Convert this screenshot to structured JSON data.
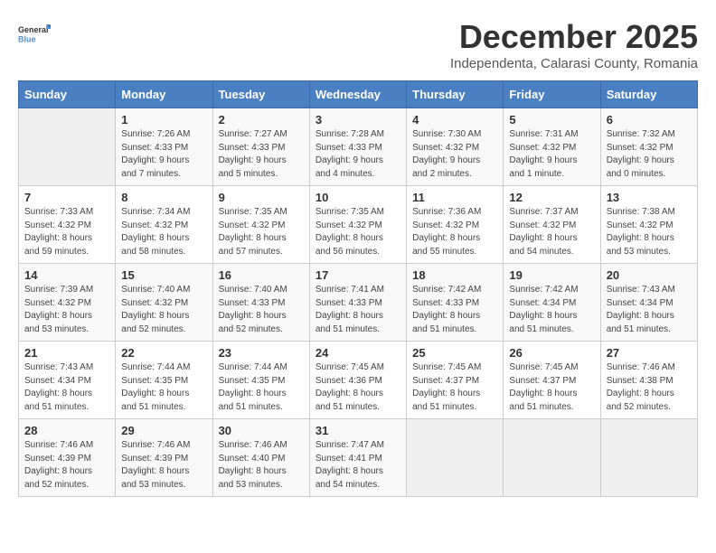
{
  "logo": {
    "general": "General",
    "blue": "Blue"
  },
  "header": {
    "month": "December 2025",
    "location": "Independenta, Calarasi County, Romania"
  },
  "weekdays": [
    "Sunday",
    "Monday",
    "Tuesday",
    "Wednesday",
    "Thursday",
    "Friday",
    "Saturday"
  ],
  "weeks": [
    [
      {
        "day": "",
        "sunrise": "",
        "sunset": "",
        "daylight": ""
      },
      {
        "day": "1",
        "sunrise": "Sunrise: 7:26 AM",
        "sunset": "Sunset: 4:33 PM",
        "daylight": "Daylight: 9 hours and 7 minutes."
      },
      {
        "day": "2",
        "sunrise": "Sunrise: 7:27 AM",
        "sunset": "Sunset: 4:33 PM",
        "daylight": "Daylight: 9 hours and 5 minutes."
      },
      {
        "day": "3",
        "sunrise": "Sunrise: 7:28 AM",
        "sunset": "Sunset: 4:33 PM",
        "daylight": "Daylight: 9 hours and 4 minutes."
      },
      {
        "day": "4",
        "sunrise": "Sunrise: 7:30 AM",
        "sunset": "Sunset: 4:32 PM",
        "daylight": "Daylight: 9 hours and 2 minutes."
      },
      {
        "day": "5",
        "sunrise": "Sunrise: 7:31 AM",
        "sunset": "Sunset: 4:32 PM",
        "daylight": "Daylight: 9 hours and 1 minute."
      },
      {
        "day": "6",
        "sunrise": "Sunrise: 7:32 AM",
        "sunset": "Sunset: 4:32 PM",
        "daylight": "Daylight: 9 hours and 0 minutes."
      }
    ],
    [
      {
        "day": "7",
        "sunrise": "Sunrise: 7:33 AM",
        "sunset": "Sunset: 4:32 PM",
        "daylight": "Daylight: 8 hours and 59 minutes."
      },
      {
        "day": "8",
        "sunrise": "Sunrise: 7:34 AM",
        "sunset": "Sunset: 4:32 PM",
        "daylight": "Daylight: 8 hours and 58 minutes."
      },
      {
        "day": "9",
        "sunrise": "Sunrise: 7:35 AM",
        "sunset": "Sunset: 4:32 PM",
        "daylight": "Daylight: 8 hours and 57 minutes."
      },
      {
        "day": "10",
        "sunrise": "Sunrise: 7:35 AM",
        "sunset": "Sunset: 4:32 PM",
        "daylight": "Daylight: 8 hours and 56 minutes."
      },
      {
        "day": "11",
        "sunrise": "Sunrise: 7:36 AM",
        "sunset": "Sunset: 4:32 PM",
        "daylight": "Daylight: 8 hours and 55 minutes."
      },
      {
        "day": "12",
        "sunrise": "Sunrise: 7:37 AM",
        "sunset": "Sunset: 4:32 PM",
        "daylight": "Daylight: 8 hours and 54 minutes."
      },
      {
        "day": "13",
        "sunrise": "Sunrise: 7:38 AM",
        "sunset": "Sunset: 4:32 PM",
        "daylight": "Daylight: 8 hours and 53 minutes."
      }
    ],
    [
      {
        "day": "14",
        "sunrise": "Sunrise: 7:39 AM",
        "sunset": "Sunset: 4:32 PM",
        "daylight": "Daylight: 8 hours and 53 minutes."
      },
      {
        "day": "15",
        "sunrise": "Sunrise: 7:40 AM",
        "sunset": "Sunset: 4:32 PM",
        "daylight": "Daylight: 8 hours and 52 minutes."
      },
      {
        "day": "16",
        "sunrise": "Sunrise: 7:40 AM",
        "sunset": "Sunset: 4:33 PM",
        "daylight": "Daylight: 8 hours and 52 minutes."
      },
      {
        "day": "17",
        "sunrise": "Sunrise: 7:41 AM",
        "sunset": "Sunset: 4:33 PM",
        "daylight": "Daylight: 8 hours and 51 minutes."
      },
      {
        "day": "18",
        "sunrise": "Sunrise: 7:42 AM",
        "sunset": "Sunset: 4:33 PM",
        "daylight": "Daylight: 8 hours and 51 minutes."
      },
      {
        "day": "19",
        "sunrise": "Sunrise: 7:42 AM",
        "sunset": "Sunset: 4:34 PM",
        "daylight": "Daylight: 8 hours and 51 minutes."
      },
      {
        "day": "20",
        "sunrise": "Sunrise: 7:43 AM",
        "sunset": "Sunset: 4:34 PM",
        "daylight": "Daylight: 8 hours and 51 minutes."
      }
    ],
    [
      {
        "day": "21",
        "sunrise": "Sunrise: 7:43 AM",
        "sunset": "Sunset: 4:34 PM",
        "daylight": "Daylight: 8 hours and 51 minutes."
      },
      {
        "day": "22",
        "sunrise": "Sunrise: 7:44 AM",
        "sunset": "Sunset: 4:35 PM",
        "daylight": "Daylight: 8 hours and 51 minutes."
      },
      {
        "day": "23",
        "sunrise": "Sunrise: 7:44 AM",
        "sunset": "Sunset: 4:35 PM",
        "daylight": "Daylight: 8 hours and 51 minutes."
      },
      {
        "day": "24",
        "sunrise": "Sunrise: 7:45 AM",
        "sunset": "Sunset: 4:36 PM",
        "daylight": "Daylight: 8 hours and 51 minutes."
      },
      {
        "day": "25",
        "sunrise": "Sunrise: 7:45 AM",
        "sunset": "Sunset: 4:37 PM",
        "daylight": "Daylight: 8 hours and 51 minutes."
      },
      {
        "day": "26",
        "sunrise": "Sunrise: 7:45 AM",
        "sunset": "Sunset: 4:37 PM",
        "daylight": "Daylight: 8 hours and 51 minutes."
      },
      {
        "day": "27",
        "sunrise": "Sunrise: 7:46 AM",
        "sunset": "Sunset: 4:38 PM",
        "daylight": "Daylight: 8 hours and 52 minutes."
      }
    ],
    [
      {
        "day": "28",
        "sunrise": "Sunrise: 7:46 AM",
        "sunset": "Sunset: 4:39 PM",
        "daylight": "Daylight: 8 hours and 52 minutes."
      },
      {
        "day": "29",
        "sunrise": "Sunrise: 7:46 AM",
        "sunset": "Sunset: 4:39 PM",
        "daylight": "Daylight: 8 hours and 53 minutes."
      },
      {
        "day": "30",
        "sunrise": "Sunrise: 7:46 AM",
        "sunset": "Sunset: 4:40 PM",
        "daylight": "Daylight: 8 hours and 53 minutes."
      },
      {
        "day": "31",
        "sunrise": "Sunrise: 7:47 AM",
        "sunset": "Sunset: 4:41 PM",
        "daylight": "Daylight: 8 hours and 54 minutes."
      },
      {
        "day": "",
        "sunrise": "",
        "sunset": "",
        "daylight": ""
      },
      {
        "day": "",
        "sunrise": "",
        "sunset": "",
        "daylight": ""
      },
      {
        "day": "",
        "sunrise": "",
        "sunset": "",
        "daylight": ""
      }
    ]
  ]
}
